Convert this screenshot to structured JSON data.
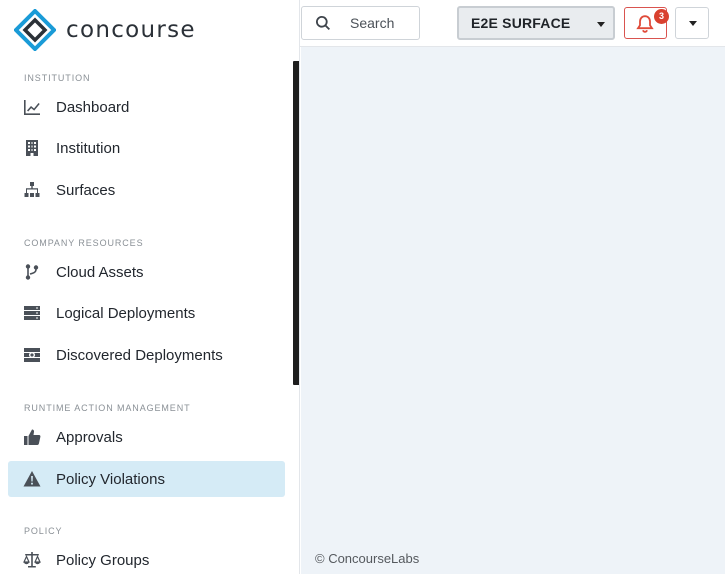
{
  "brand": {
    "name": "concourse"
  },
  "sidebar": {
    "sections": [
      {
        "label": "INSTITUTION"
      },
      {
        "label": "COMPANY RESOURCES"
      },
      {
        "label": "RUNTIME ACTION MANAGEMENT"
      },
      {
        "label": "POLICY"
      }
    ],
    "items": [
      {
        "label": "Dashboard",
        "icon": "chart-line-icon"
      },
      {
        "label": "Institution",
        "icon": "building-icon"
      },
      {
        "label": "Surfaces",
        "icon": "sitemap-icon"
      },
      {
        "label": "Cloud Assets",
        "icon": "code-branch-icon"
      },
      {
        "label": "Logical Deployments",
        "icon": "server-icon"
      },
      {
        "label": "Discovered Deployments",
        "icon": "server-search-icon"
      },
      {
        "label": "Approvals",
        "icon": "thumbs-up-icon"
      },
      {
        "label": "Policy Violations",
        "icon": "warning-icon",
        "active": true
      },
      {
        "label": "Policy Groups",
        "icon": "balance-scale-icon"
      }
    ]
  },
  "header": {
    "search_label": "Search",
    "surface_selected": "E2E SURFACE",
    "notifications_count": "3"
  },
  "footer": {
    "text": "© ConcourseLabs"
  },
  "colors": {
    "active_item_bg": "#d5ebf6",
    "main_bg": "#eef3f8",
    "alert_red": "#d9412f",
    "logo_blue": "#1a9bd7"
  }
}
